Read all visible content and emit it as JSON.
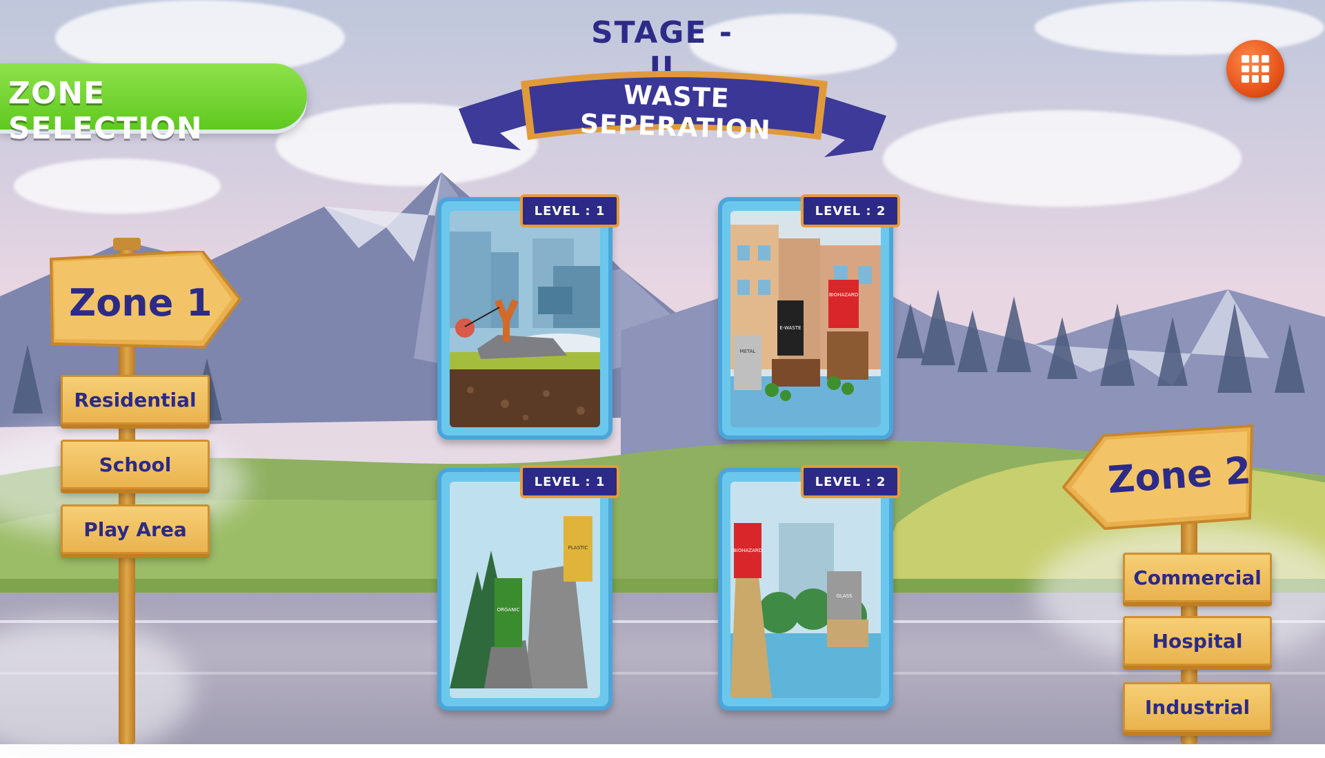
{
  "header": {
    "stage_title": "STAGE - II",
    "banner_title": "WASTE SEPERATION",
    "zone_selection_label": "ZONE SELECTION",
    "menu_icon": "grid-menu-icon"
  },
  "colors": {
    "title_navy": "#2d2b87",
    "zone_tab_green": "#5fc91f",
    "menu_orange": "#e8541a",
    "card_blue": "#6bc7ec",
    "badge_border_orange": "#e69b3c",
    "plank_yellow": "#eab34f"
  },
  "levels": [
    {
      "label": "LEVEL : 1",
      "scene": "slingshot-field"
    },
    {
      "label": "LEVEL : 2",
      "scene": "bins-city-metal-ewaste-biohazard"
    },
    {
      "label": "LEVEL : 1",
      "scene": "bins-forest-organic-plastic"
    },
    {
      "label": "LEVEL : 2",
      "scene": "bins-river-biohazard-glass"
    }
  ],
  "bin_labels": {
    "metal": "METAL",
    "ewaste": "E-WASTE",
    "biohazard": "BIOHAZARD",
    "organic": "ORGANIC",
    "plastic": "PLASTIC",
    "glass": "GLASS"
  },
  "zone1": {
    "title": "Zone 1",
    "items": [
      "Residential",
      "School",
      "Play Area"
    ]
  },
  "zone2": {
    "title": "Zone 2",
    "items": [
      "Commercial",
      "Hospital",
      "Industrial"
    ]
  }
}
